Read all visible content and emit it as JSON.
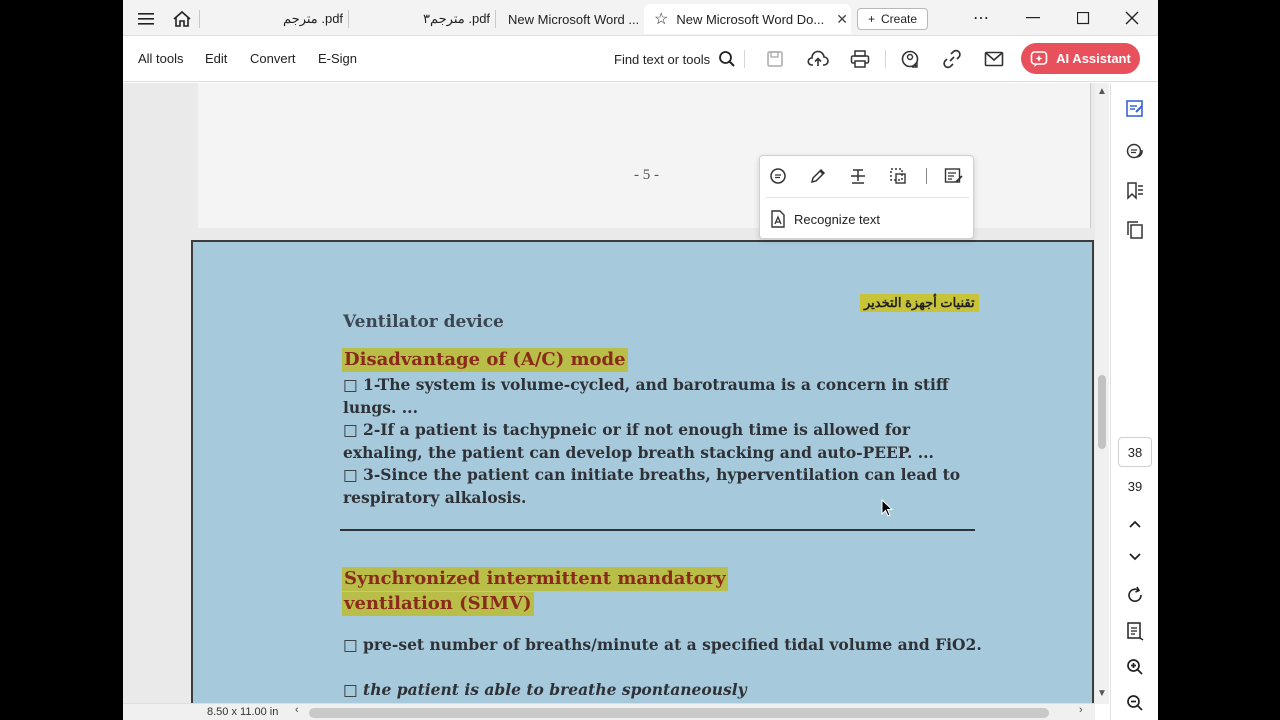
{
  "tabs": [
    {
      "label": "مترجم .pdf",
      "active": false
    },
    {
      "label": "مترجم٣ .pdf",
      "active": false
    },
    {
      "label": "New Microsoft Word ...",
      "active": false
    },
    {
      "label": "New Microsoft Word Do...",
      "active": true
    }
  ],
  "create_label": "Create",
  "menu": {
    "all_tools": "All tools",
    "edit": "Edit",
    "convert": "Convert",
    "esign": "E-Sign"
  },
  "find_label": "Find text or tools",
  "ai_label": "AI Assistant",
  "popup": {
    "recognize_text": "Recognize text"
  },
  "page_prev": {
    "number": "- 5 -"
  },
  "document": {
    "arabic_heading": "تقنيات أجهزة التخدير",
    "title": "Ventilator device",
    "section1_heading": "Disadvantage of (A/C) mode",
    "p1": "□ 1-The system is volume-cycled, and barotrauma is a concern in stiff lungs. ...",
    "p2": "□ 2-If a patient is tachypneic or if not enough time is allowed for exhaling, the patient can develop breath stacking and auto-PEEP. ...",
    "p3": "□ 3-Since the patient can initiate breaths, hyperventilation can lead to respiratory alkalosis.",
    "section2_heading_line1": "Synchronized intermittent mandatory",
    "section2_heading_line2": "ventilation (SIMV)",
    "p4": "□ pre-set number of breaths/minute at a specified tidal volume and FiO2.",
    "p5": "□ the patient is able to breathe spontaneously"
  },
  "pagination": {
    "current": "38",
    "total": "39"
  },
  "status": {
    "page_size": "8.50 x 11.00 in"
  },
  "colors": {
    "accent": "#e8505b",
    "page_bg": "#a7c9dc",
    "highlight": "#b9be49",
    "heading_text": "#8a2a1a"
  },
  "icons": [
    "hamburger-icon",
    "home-icon",
    "star-icon",
    "close-icon",
    "plus-icon",
    "more-icon",
    "minimize-icon",
    "maximize-icon",
    "window-close-icon",
    "search-icon",
    "save-icon",
    "upload-icon",
    "print-icon",
    "share-icon",
    "link-icon",
    "mail-icon",
    "ai-icon",
    "comment-icon",
    "highlight-pen-icon",
    "strikethrough-icon",
    "select-region-icon",
    "edit-text-icon",
    "recognize-text-icon",
    "edit-pdf-icon",
    "comments-panel-icon",
    "bookmark-icon",
    "pages-icon",
    "chevron-up-icon",
    "chevron-down-icon",
    "refresh-icon",
    "page-view-icon",
    "zoom-in-icon",
    "zoom-out-icon"
  ]
}
